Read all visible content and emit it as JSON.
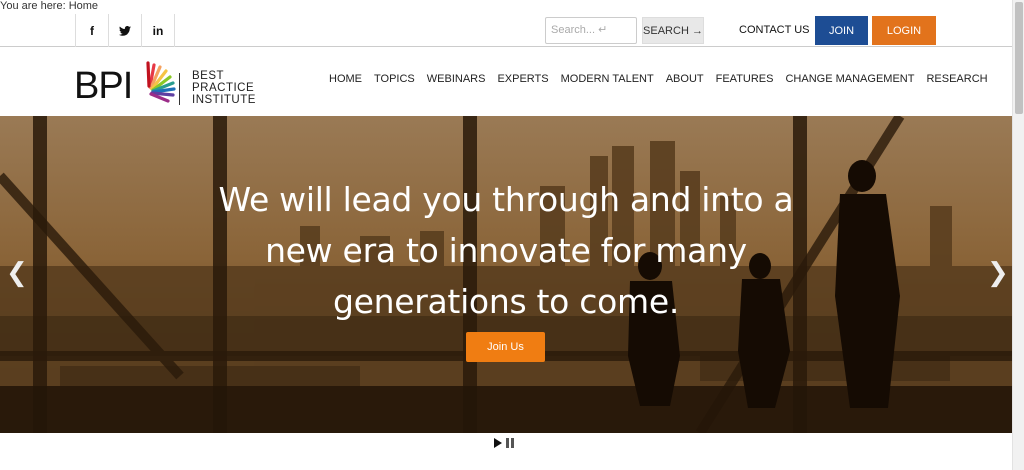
{
  "breadcrumb": "You are here: Home",
  "social": [
    {
      "icon": "facebook-icon",
      "glyph": "f"
    },
    {
      "icon": "twitter-icon",
      "glyph": "🐦"
    },
    {
      "icon": "linkedin-icon",
      "glyph": "in"
    }
  ],
  "search": {
    "placeholder": "Search... ↵",
    "button_label": "SEARCH →"
  },
  "topbar": {
    "contact_label": "CONTACT US",
    "join_label": "JOIN",
    "login_label": "LOGIN"
  },
  "logo": {
    "letters": "BPI",
    "name_line1": "BEST",
    "name_line2": "PRACTICE",
    "name_line3": "INSTITUTE"
  },
  "nav": [
    "HOME",
    "TOPICS",
    "WEBINARS",
    "EXPERTS",
    "MODERN TALENT",
    "ABOUT",
    "FEATURES",
    "CHANGE MANAGEMENT",
    "RESEARCH"
  ],
  "hero": {
    "headline": "We will lead you through and into a new era to innovate for many generations to come.",
    "cta_label": "Join Us",
    "prev_arrow": "❮",
    "next_arrow": "❯"
  },
  "colors": {
    "join": "#1d4d94",
    "login": "#e2731c",
    "cta": "#f07d12",
    "hero_tint": "#6b4c2a"
  }
}
